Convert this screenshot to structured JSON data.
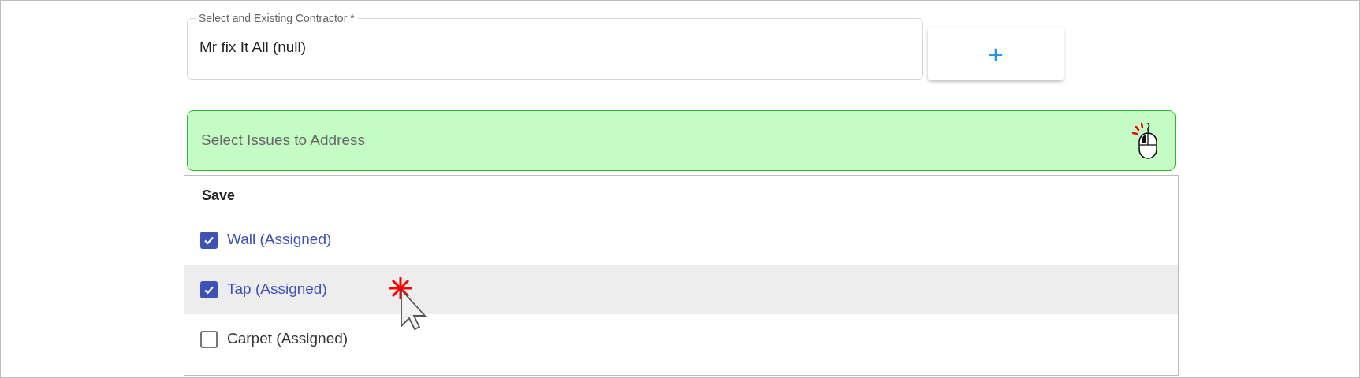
{
  "contractor_field": {
    "label": "Select and Existing Contractor *",
    "value": "Mr fix It All (null)"
  },
  "add_button": {
    "label": "+"
  },
  "issues_field": {
    "placeholder": "Select Issues to Address"
  },
  "dropdown": {
    "action": "Save",
    "items": [
      {
        "label": "Wall (Assigned)",
        "checked": true,
        "hovered": false
      },
      {
        "label": "Tap (Assigned)",
        "checked": true,
        "hovered": true
      },
      {
        "label": "Carpet (Assigned)",
        "checked": false,
        "hovered": false
      }
    ]
  }
}
